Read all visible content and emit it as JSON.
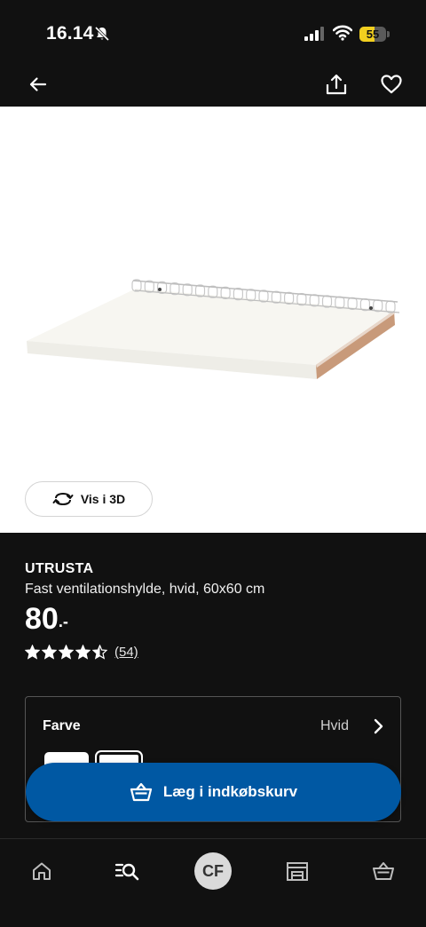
{
  "status_bar": {
    "time": "16.14",
    "battery_level": 55,
    "battery_text": "55",
    "icons": [
      "bell-slash-icon",
      "cellular-signal-icon",
      "wifi-icon",
      "battery-icon"
    ]
  },
  "nav": {
    "icons": [
      "arrow-left-icon",
      "share-icon",
      "heart-icon"
    ]
  },
  "media": {
    "view_3d_label": "Vis i 3D",
    "view_3d_icon": "rotate-3d-icon"
  },
  "product": {
    "name": "UTRUSTA",
    "description": "Fast ventilationshylde, hvid, 60x60 cm",
    "price": "80",
    "price_suffix": ".-",
    "rating": 4.5,
    "rating_max": 5,
    "review_count": "(54)"
  },
  "color_selector": {
    "label": "Farve",
    "value": "Hvid",
    "swatches": [
      {
        "color": "#ffffff",
        "selected": false
      },
      {
        "color": "#ffffff",
        "selected": true
      }
    ]
  },
  "cart_button": {
    "label": "Læg i indkøbskurv",
    "icon": "shopping-basket-icon",
    "color": "#0058a3"
  },
  "tab_bar": {
    "tabs": [
      {
        "icon": "home-icon"
      },
      {
        "icon": "search-list-icon"
      },
      {
        "initials": "CF"
      },
      {
        "icon": "store-icon"
      },
      {
        "icon": "basket-icon"
      }
    ]
  },
  "colors": {
    "background": "#111111",
    "accent": "#0058a3",
    "battery": "#f2cf1f"
  }
}
